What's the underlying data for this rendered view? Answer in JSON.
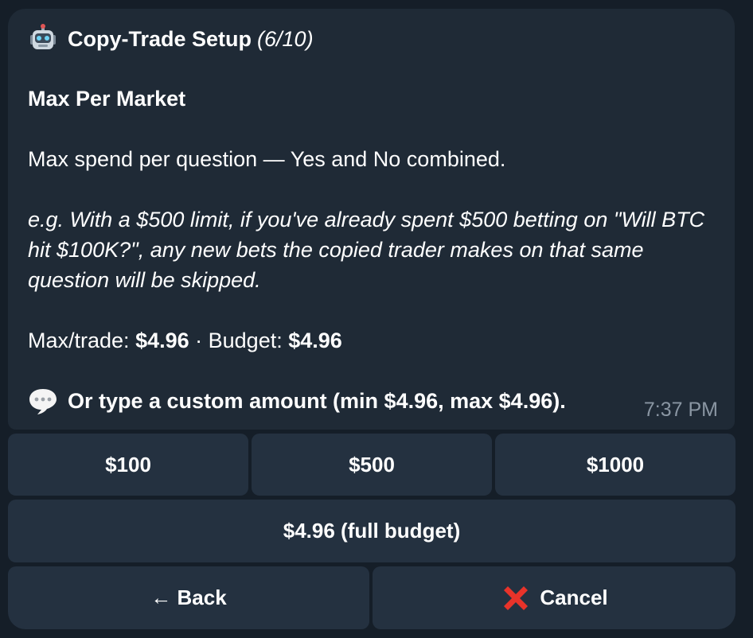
{
  "message": {
    "title": "Copy-Trade Setup",
    "step": "(6/10)",
    "heading": "Max Per Market",
    "description": "Max spend per question — Yes and No combined.",
    "example": "e.g. With a $500 limit, if you've already spent $500 betting on \"Will BTC hit $100K?\", any new bets the copied trader makes on that same question will be skipped.",
    "max_trade_label": "Max/trade: ",
    "max_trade_value": "$4.96",
    "separator": " · Budget: ",
    "budget_value": "$4.96",
    "hint": "Or type a custom amount (min $4.96, max $4.96).",
    "time": "7:37 PM",
    "title_icon": "robot-icon",
    "hint_icon": "speech-bubble-icon"
  },
  "buttons": {
    "amount_100": "$100",
    "amount_500": "$500",
    "amount_1000": "$1000",
    "full_budget": "$4.96 (full budget)",
    "back": "← Back",
    "cancel": "Cancel",
    "cancel_icon": "cross-mark-icon"
  },
  "colors": {
    "background": "#151e28",
    "bubble": "#1f2a36",
    "button": "#243140",
    "time": "#8a96a3",
    "cancel_cross": "#e8332a"
  }
}
